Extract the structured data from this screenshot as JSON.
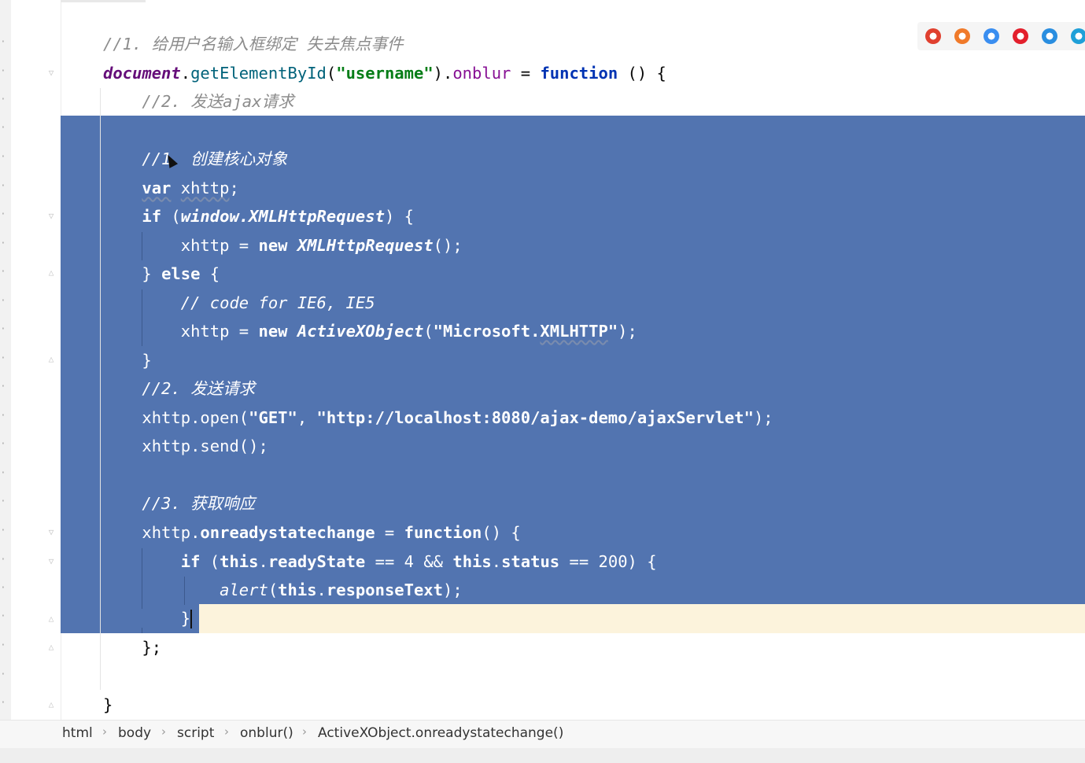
{
  "editor": {
    "lines": [
      {
        "parts": [
          {
            "t": "//1. ",
            "c": "cm"
          },
          {
            "t": "给用户名输入框绑定 失去焦点事件",
            "c": "cm cn"
          }
        ]
      },
      {
        "parts": [
          {
            "t": "document",
            "c": "glob"
          },
          {
            "t": ".",
            "c": ""
          },
          {
            "t": "getElementById",
            "c": "fn"
          },
          {
            "t": "(",
            "c": ""
          },
          {
            "t": "\"username\"",
            "c": "str"
          },
          {
            "t": ").",
            "c": ""
          },
          {
            "t": "onblur",
            "c": "prop"
          },
          {
            "t": " = ",
            "c": ""
          },
          {
            "t": "function",
            "c": "kw"
          },
          {
            "t": " () {",
            "c": ""
          }
        ]
      },
      {
        "parts": [
          {
            "t": "    //2. ",
            "c": "cm"
          },
          {
            "t": "发送",
            "c": "cm cn"
          },
          {
            "t": "ajax",
            "c": "cm"
          },
          {
            "t": "请求",
            "c": "cm cn"
          }
        ]
      },
      {
        "parts": []
      },
      {
        "parts": [
          {
            "t": "    //1. ",
            "c": "cm"
          },
          {
            "t": "创建核心对象",
            "c": "cm cn"
          }
        ]
      },
      {
        "parts": [
          {
            "t": "    ",
            "c": ""
          },
          {
            "t": "var",
            "c": "kw wavy"
          },
          {
            "t": " ",
            "c": ""
          },
          {
            "t": "xhttp",
            "c": "wavy"
          },
          {
            "t": ";",
            "c": ""
          }
        ]
      },
      {
        "parts": [
          {
            "t": "    ",
            "c": ""
          },
          {
            "t": "if",
            "c": "kw"
          },
          {
            "t": " (",
            "c": ""
          },
          {
            "t": "window.XMLHttpRequest",
            "c": "it b"
          },
          {
            "t": ") {",
            "c": ""
          }
        ]
      },
      {
        "parts": [
          {
            "t": "        xhttp = ",
            "c": ""
          },
          {
            "t": "new",
            "c": "kw"
          },
          {
            "t": " ",
            "c": ""
          },
          {
            "t": "XMLHttpRequest",
            "c": "it b"
          },
          {
            "t": "();",
            "c": ""
          }
        ]
      },
      {
        "parts": [
          {
            "t": "    } ",
            "c": ""
          },
          {
            "t": "else",
            "c": "kw"
          },
          {
            "t": " {",
            "c": ""
          }
        ]
      },
      {
        "parts": [
          {
            "t": "        // code for IE6, IE5",
            "c": "cm"
          }
        ]
      },
      {
        "parts": [
          {
            "t": "        xhttp = ",
            "c": ""
          },
          {
            "t": "new",
            "c": "kw"
          },
          {
            "t": " ",
            "c": ""
          },
          {
            "t": "ActiveXObject",
            "c": "it b"
          },
          {
            "t": "(",
            "c": ""
          },
          {
            "t": "\"Microsoft.",
            "c": "str"
          },
          {
            "t": "XMLHTTP",
            "c": "str wavy"
          },
          {
            "t": "\"",
            "c": "str"
          },
          {
            "t": ");",
            "c": ""
          }
        ]
      },
      {
        "parts": [
          {
            "t": "    }",
            "c": ""
          }
        ]
      },
      {
        "parts": [
          {
            "t": "    //2. ",
            "c": "cm"
          },
          {
            "t": "发送请求",
            "c": "cm cn"
          }
        ]
      },
      {
        "parts": [
          {
            "t": "    xhttp.open(",
            "c": ""
          },
          {
            "t": "\"GET\"",
            "c": "str"
          },
          {
            "t": ", ",
            "c": ""
          },
          {
            "t": "\"http://localhost:8080/ajax-demo/ajaxServlet\"",
            "c": "str"
          },
          {
            "t": ");",
            "c": ""
          }
        ]
      },
      {
        "parts": [
          {
            "t": "    xhttp.send();",
            "c": ""
          }
        ]
      },
      {
        "parts": []
      },
      {
        "parts": [
          {
            "t": "    //3. ",
            "c": "cm"
          },
          {
            "t": "获取响应",
            "c": "cm cn"
          }
        ]
      },
      {
        "parts": [
          {
            "t": "    xhttp.",
            "c": ""
          },
          {
            "t": "onreadystatechange",
            "c": "b"
          },
          {
            "t": " = ",
            "c": ""
          },
          {
            "t": "function",
            "c": "kw"
          },
          {
            "t": "() {",
            "c": ""
          }
        ]
      },
      {
        "parts": [
          {
            "t": "        ",
            "c": ""
          },
          {
            "t": "if",
            "c": "kw"
          },
          {
            "t": " (",
            "c": ""
          },
          {
            "t": "this",
            "c": "kw"
          },
          {
            "t": ".",
            "c": ""
          },
          {
            "t": "readyState",
            "c": "b"
          },
          {
            "t": " == 4 && ",
            "c": ""
          },
          {
            "t": "this",
            "c": "kw"
          },
          {
            "t": ".",
            "c": ""
          },
          {
            "t": "status",
            "c": "b"
          },
          {
            "t": " == 200) {",
            "c": ""
          }
        ]
      },
      {
        "parts": [
          {
            "t": "            ",
            "c": ""
          },
          {
            "t": "alert",
            "c": "it"
          },
          {
            "t": "(",
            "c": ""
          },
          {
            "t": "this",
            "c": "kw"
          },
          {
            "t": ".",
            "c": ""
          },
          {
            "t": "responseText",
            "c": "b"
          },
          {
            "t": ");",
            "c": ""
          }
        ]
      },
      {
        "parts": [
          {
            "t": "        }",
            "c": ""
          }
        ]
      },
      {
        "parts": [
          {
            "t": "    };",
            "c": ""
          }
        ]
      },
      {
        "parts": []
      },
      {
        "parts": [
          {
            "t": "}",
            "c": ""
          }
        ]
      }
    ]
  },
  "breadcrumb": [
    "html",
    "body",
    "script",
    "onblur()",
    "ActiveXObject.onreadystatechange()"
  ],
  "browser_icons": [
    {
      "name": "chrome-icon",
      "color": "#e0402f"
    },
    {
      "name": "firefox-icon",
      "color": "#f07a2a"
    },
    {
      "name": "safari-icon",
      "color": "#3a8ef0"
    },
    {
      "name": "opera-icon",
      "color": "#e3202d"
    },
    {
      "name": "ie-icon",
      "color": "#2a8ee0"
    },
    {
      "name": "edge-icon",
      "color": "#1fa0d8"
    }
  ],
  "colors": {
    "selection": "#5274b0",
    "current_line": "#fcf3dc",
    "keyword": "#0033b3",
    "string": "#067d17",
    "comment": "#8c8c8c"
  }
}
